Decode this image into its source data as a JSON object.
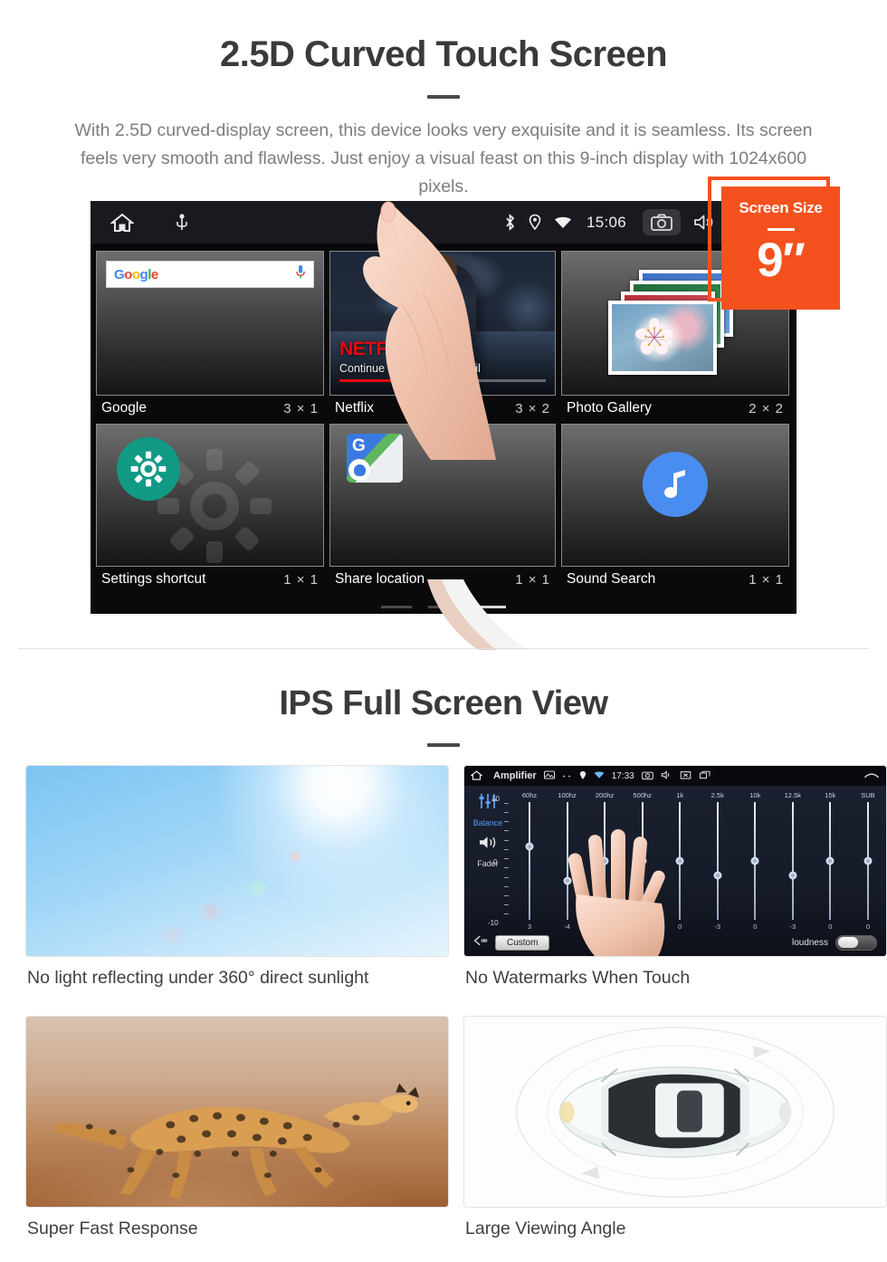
{
  "section_one": {
    "title": "2.5D Curved Touch Screen",
    "description": "With 2.5D curved-display screen, this device looks very exquisite and it is seamless. Its screen feels very smooth and flawless. Just enjoy a visual feast on this 9-inch display with 1024x600 pixels.",
    "badge": {
      "title": "Screen Size",
      "value": "9″"
    },
    "device": {
      "statusbar": {
        "home_icon": "home-icon",
        "usb_icon": "usb-icon",
        "bluetooth_icon": "bluetooth-icon",
        "location_icon": "location-pin-icon",
        "wifi_icon": "wifi-icon",
        "clock": "15:06",
        "camera_icon": "camera-icon",
        "volume_icon": "volume-icon",
        "close_icon": "close-box-icon",
        "recents_icon": "recents-icon"
      },
      "widgets": [
        {
          "name": "Google",
          "size": "3 × 1",
          "icon": "google-search-widget",
          "search_placeholder": ""
        },
        {
          "name": "Netflix",
          "size": "3 × 2",
          "icon": "netflix-widget",
          "brand": "NETFLIX",
          "subtitle": "Continue Marvel's Daredevil"
        },
        {
          "name": "Photo Gallery",
          "size": "2 × 2",
          "icon": "photo-gallery-widget"
        },
        {
          "name": "Settings shortcut",
          "size": "1 × 1",
          "icon": "gear-icon"
        },
        {
          "name": "Share location",
          "size": "1 × 1",
          "icon": "maps-share-location-icon"
        },
        {
          "name": "Sound Search",
          "size": "1 × 1",
          "icon": "music-note-icon"
        }
      ],
      "page_indicator": {
        "count": 3,
        "active_index": 2
      }
    }
  },
  "section_two": {
    "title": "IPS Full Screen View",
    "cards": [
      {
        "caption": "No light reflecting under 360° direct sunlight",
        "image": "sunlight-sky-photo"
      },
      {
        "caption": "No Watermarks When Touch",
        "image": "amplifier-equalizer-screen"
      },
      {
        "caption": "Super Fast Response",
        "image": "running-cheetah-photo"
      },
      {
        "caption": "Large Viewing Angle",
        "image": "car-top-view-illustration"
      }
    ]
  },
  "amplifier": {
    "home_icon": "home-icon",
    "title": "Amplifier",
    "gallery_icon": "gallery-icon",
    "more_icon": "more-icon",
    "location_icon": "location-pin-icon",
    "wifi_icon": "wifi-icon",
    "clock": "17:33",
    "camera_icon": "camera-icon",
    "volume_icon": "volume-icon",
    "close_icon": "close-box-icon",
    "recents_icon": "recents-icon",
    "back_icon": "back-icon",
    "balance_label": "Balance",
    "fader_label": "Fader",
    "scale_top": "10",
    "scale_mid": "0",
    "scale_bottom": "-10",
    "preset_button": "Custom",
    "loudness_label": "loudness",
    "loudness_on": false,
    "bands": [
      {
        "label": "60hz",
        "value": "3"
      },
      {
        "label": "100hz",
        "value": "-4"
      },
      {
        "label": "200hz",
        "value": "0"
      },
      {
        "label": "500hz",
        "value": "0"
      },
      {
        "label": "1k",
        "value": "0"
      },
      {
        "label": "2.5k",
        "value": "-3"
      },
      {
        "label": "10k",
        "value": "0"
      },
      {
        "label": "12.5k",
        "value": "-3"
      },
      {
        "label": "15k",
        "value": "0"
      },
      {
        "label": "SUB",
        "value": "0"
      }
    ]
  },
  "colors": {
    "accent_orange": "#F4511E",
    "netflix_red": "#E50914",
    "settings_teal": "#119A84",
    "sound_blue": "#4A8DF0",
    "heading": "#3A3A3A",
    "body_text": "#7D7D7D"
  }
}
